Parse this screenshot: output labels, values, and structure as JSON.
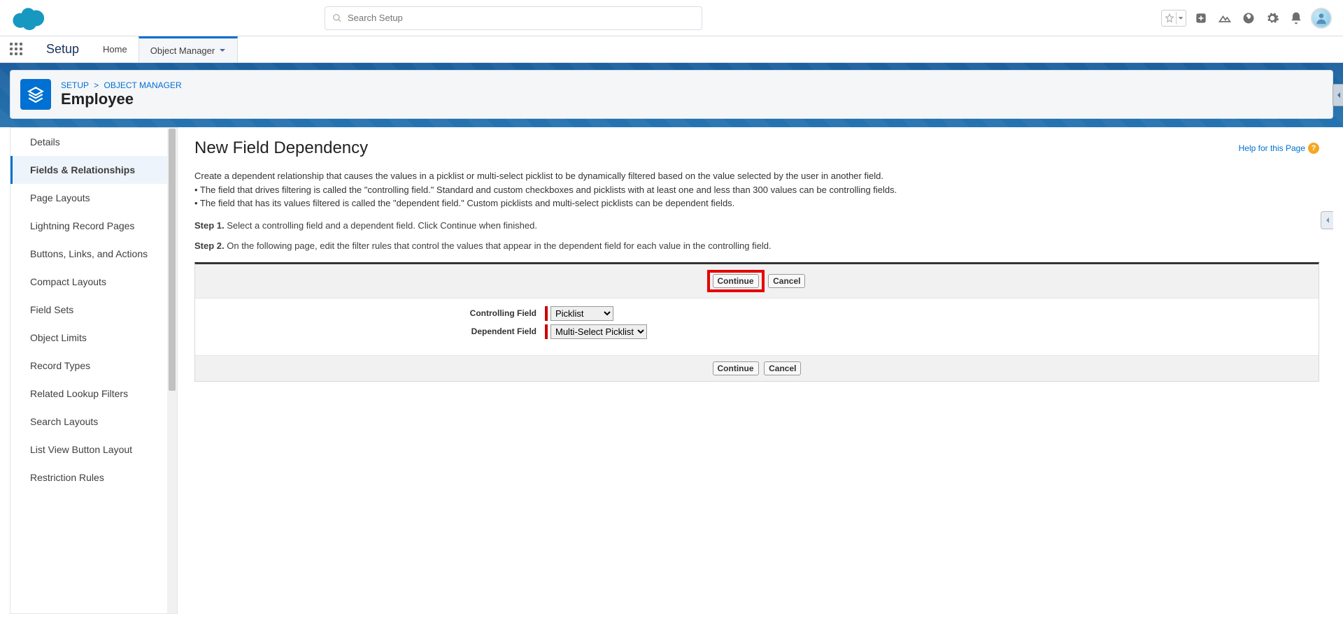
{
  "search": {
    "placeholder": "Search Setup"
  },
  "nav": {
    "app": "Setup",
    "home": "Home",
    "object_mgr": "Object Manager"
  },
  "breadcrumb": {
    "setup": "SETUP",
    "om": "OBJECT MANAGER"
  },
  "object_name": "Employee",
  "sidebar": {
    "items": [
      {
        "label": "Details"
      },
      {
        "label": "Fields & Relationships"
      },
      {
        "label": "Page Layouts"
      },
      {
        "label": "Lightning Record Pages"
      },
      {
        "label": "Buttons, Links, and Actions"
      },
      {
        "label": "Compact Layouts"
      },
      {
        "label": "Field Sets"
      },
      {
        "label": "Object Limits"
      },
      {
        "label": "Record Types"
      },
      {
        "label": "Related Lookup Filters"
      },
      {
        "label": "Search Layouts"
      },
      {
        "label": "List View Button Layout"
      },
      {
        "label": "Restriction Rules"
      }
    ]
  },
  "content": {
    "title": "New Field Dependency",
    "help": "Help for this Page",
    "desc_intro": "Create a dependent relationship that causes the values in a picklist or multi-select picklist to be dynamically filtered based on the value selected by the user in another field.",
    "desc_b1": "• The field that drives filtering is called the \"controlling field.\" Standard and custom checkboxes and picklists with at least one and less than 300 values can be controlling fields.",
    "desc_b2": "• The field that has its values filtered is called the \"dependent field.\" Custom picklists and multi-select picklists can be dependent fields.",
    "step1_label": "Step 1.",
    "step1_text": " Select a controlling field and a dependent field. Click Continue when finished.",
    "step2_label": "Step 2.",
    "step2_text": " On the following page, edit the filter rules that control the values that appear in the dependent field for each value in the controlling field.",
    "continue": "Continue",
    "cancel": "Cancel",
    "controlling_label": "Controlling Field",
    "dependent_label": "Dependent Field",
    "controlling_value": "Picklist",
    "dependent_value": "Multi-Select Picklist"
  }
}
